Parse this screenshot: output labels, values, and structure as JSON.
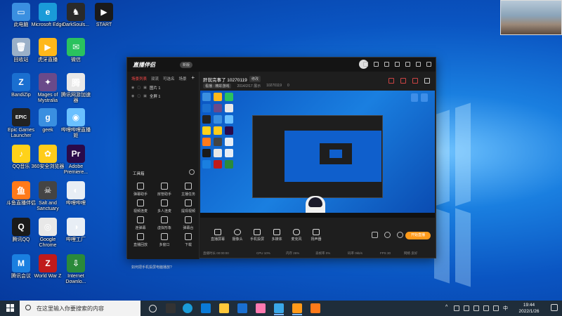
{
  "desktop": {
    "icons": [
      {
        "label": "此电脑",
        "glyph": "▭",
        "color": "#3a8fe0"
      },
      {
        "label": "Microsoft Edge",
        "glyph": "e",
        "color": "#1a9bd8"
      },
      {
        "label": "DarkSouls...",
        "glyph": "♞",
        "color": "#2a2a2a"
      },
      {
        "label": "START",
        "glyph": "▶",
        "color": "#1a1a1a"
      },
      {
        "label": "回收站",
        "glyph": "🗑",
        "color": "#9ab0c8"
      },
      {
        "label": "虎牙直播",
        "glyph": "▶",
        "color": "#ffb81a"
      },
      {
        "label": "微信",
        "glyph": "✉",
        "color": "#2ac25e"
      },
      {
        "label": "BandiZip",
        "glyph": "Z",
        "color": "#1a6fd0"
      },
      {
        "label": "Mages of Mystralia",
        "glyph": "✦",
        "color": "#6a4a8a"
      },
      {
        "label": "腾讯网游加速器",
        "glyph": "腾",
        "color": "#e8e8e8"
      },
      {
        "label": "Epic Games Launcher",
        "glyph": "EPIC",
        "color": "#222"
      },
      {
        "label": "geek",
        "glyph": "g",
        "color": "#3a8fe0"
      },
      {
        "label": "哔哩哔哩直播姬",
        "glyph": "◉",
        "color": "#6ac0ff"
      },
      {
        "label": "QQ音乐",
        "glyph": "♪",
        "color": "#ffd21a"
      },
      {
        "label": "360安全浏览器",
        "glyph": "✿",
        "color": "#ffcc1a"
      },
      {
        "label": "Adobe Premiere...",
        "glyph": "Pr",
        "color": "#2a0a4a"
      },
      {
        "label": "斗鱼直播伴侣",
        "glyph": "鱼",
        "color": "#ff7a1a"
      },
      {
        "label": "Salt and Sanctuary",
        "glyph": "☠",
        "color": "#444"
      },
      {
        "label": "哔哩哔哩",
        "glyph": "◐",
        "color": "#e8eef5"
      },
      {
        "label": "腾讯QQ",
        "glyph": "Q",
        "color": "#1a1a1a"
      },
      {
        "label": "Google Chrome",
        "glyph": "◎",
        "color": "#e8e8e8"
      },
      {
        "label": "哔哩工厂",
        "glyph": "◑",
        "color": "#e8eef5"
      },
      {
        "label": "腾讯会议",
        "glyph": "M",
        "color": "#1a7fe0"
      },
      {
        "label": "World War Z",
        "glyph": "Z",
        "color": "#c01a1a"
      },
      {
        "label": "Internet Downlo...",
        "glyph": "⇩",
        "color": "#2a8a3a"
      }
    ]
  },
  "app": {
    "logo": "直播伴侣",
    "badge": "新版",
    "tabs": [
      "场景列表",
      "双流",
      "可选名",
      "场景",
      "+"
    ],
    "scenes": [
      {
        "label": "图片 1"
      },
      {
        "label": "全屏 1"
      }
    ],
    "tools_title": "工具箱",
    "tools": [
      "弹幕助手",
      "房管助手",
      "主播任务",
      "视频连麦",
      "多人连麦",
      "提现视频",
      "连弹幕",
      "虚拟形象",
      "弹幕台",
      "直播回放",
      "多窗口",
      "下载"
    ],
    "notice": "如何把手机投屏电脑播放?",
    "room_title": "肝就完事了 10270119",
    "room_edit": "修改",
    "room_tag": "看播 · 精彩游戏",
    "room_date": "2014/2/17 展示",
    "room_id": "10270119",
    "room_count": "0",
    "controls": [
      "直播屏幕",
      "摄像头",
      "手机投屏",
      "多媒体",
      "麦克风",
      "扬声器"
    ],
    "go_live": "开始直播",
    "status": [
      "直播时长 00:00:00",
      "CPU 10%",
      "内存 26%",
      "丢帧率 0%",
      "码率 0kb/s",
      "FPS 30",
      "网络 良好"
    ]
  },
  "taskbar": {
    "search_placeholder": "在这里输入你要搜索的内容",
    "time": "19:44",
    "date": "2022/1/26",
    "ime": "中"
  }
}
